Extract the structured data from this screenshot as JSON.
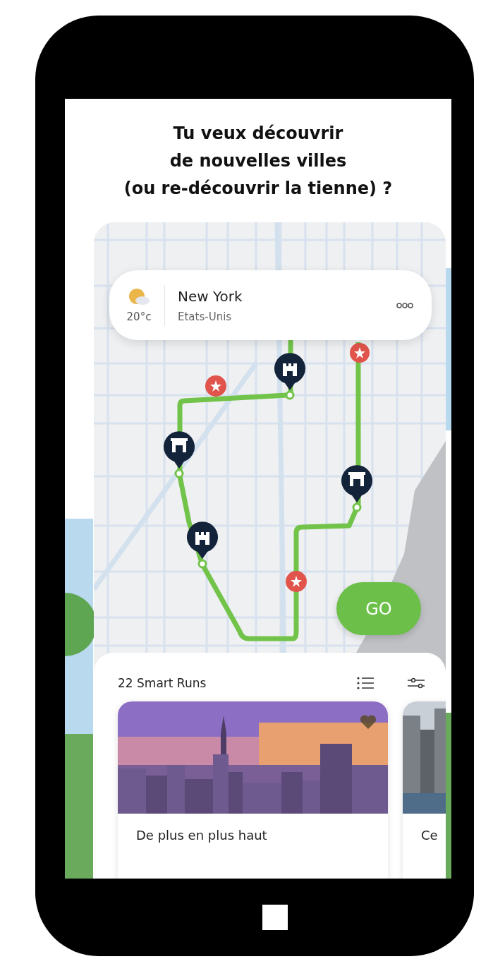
{
  "headline": [
    "Tu veux découvrir",
    "de nouvelles villes",
    "(ou re-découvrir la tienne) ?"
  ],
  "weather": {
    "temperature": "20°c",
    "city": "New York",
    "country": "Etats-Unis"
  },
  "go_button": "GO",
  "runs_sheet": {
    "title": "22 Smart Runs",
    "runs": [
      {
        "title": "De plus en plus haut"
      },
      {
        "title": "Ce"
      }
    ]
  }
}
